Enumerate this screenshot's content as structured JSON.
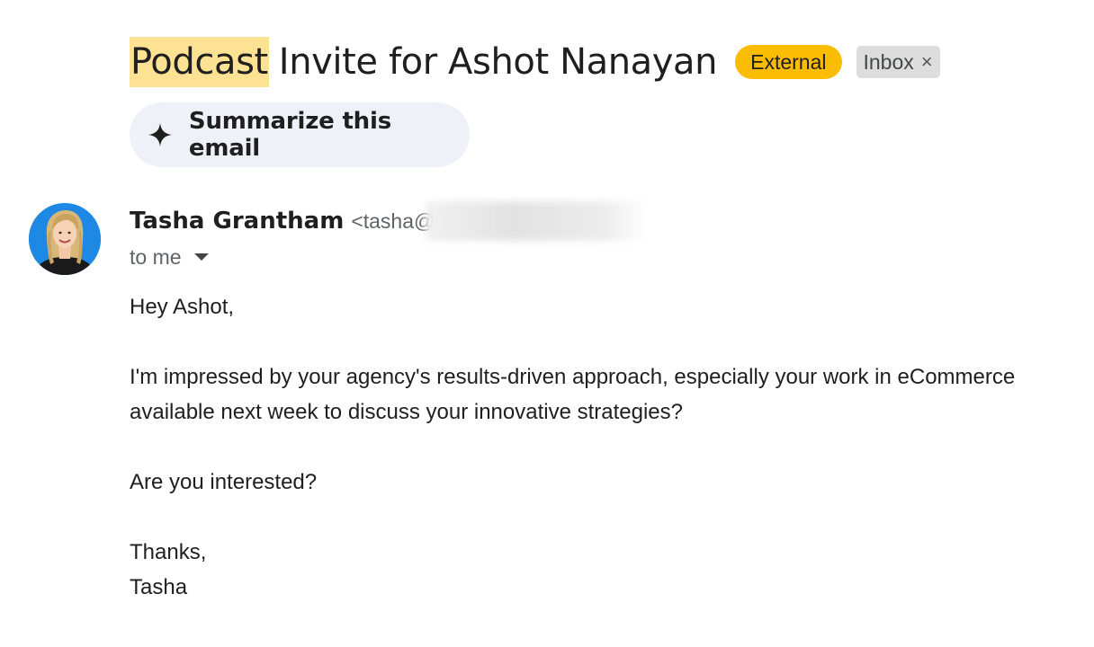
{
  "email": {
    "subject_highlight": "Podcast",
    "subject_rest": "Invite for Ashot Nanayan",
    "labels": {
      "external": "External",
      "inbox": "Inbox",
      "inbox_remove": "×"
    },
    "summarize_label": "Summarize this email",
    "sender": {
      "name": "Tasha Grantham",
      "email_visible": "<tasha@",
      "recipient": "to me"
    },
    "body": {
      "greeting": "Hey Ashot,",
      "para1_line1": "I'm impressed by your agency's results-driven approach, especially your work in eCommerce",
      "para1_line2": "available next week to discuss your innovative strategies?",
      "question": "Are you interested?",
      "signoff": "Thanks,",
      "signature": "Tasha"
    }
  },
  "colors": {
    "highlight": "#fde293",
    "external_badge": "#fbbc04",
    "inbox_badge": "#dddddd",
    "summarize_bg": "#eef2f8",
    "avatar_bg": "#1e88e5"
  },
  "icons": {
    "summarize": "sparkle-icon",
    "recipient_details": "caret-down-icon",
    "avatar": "avatar"
  }
}
